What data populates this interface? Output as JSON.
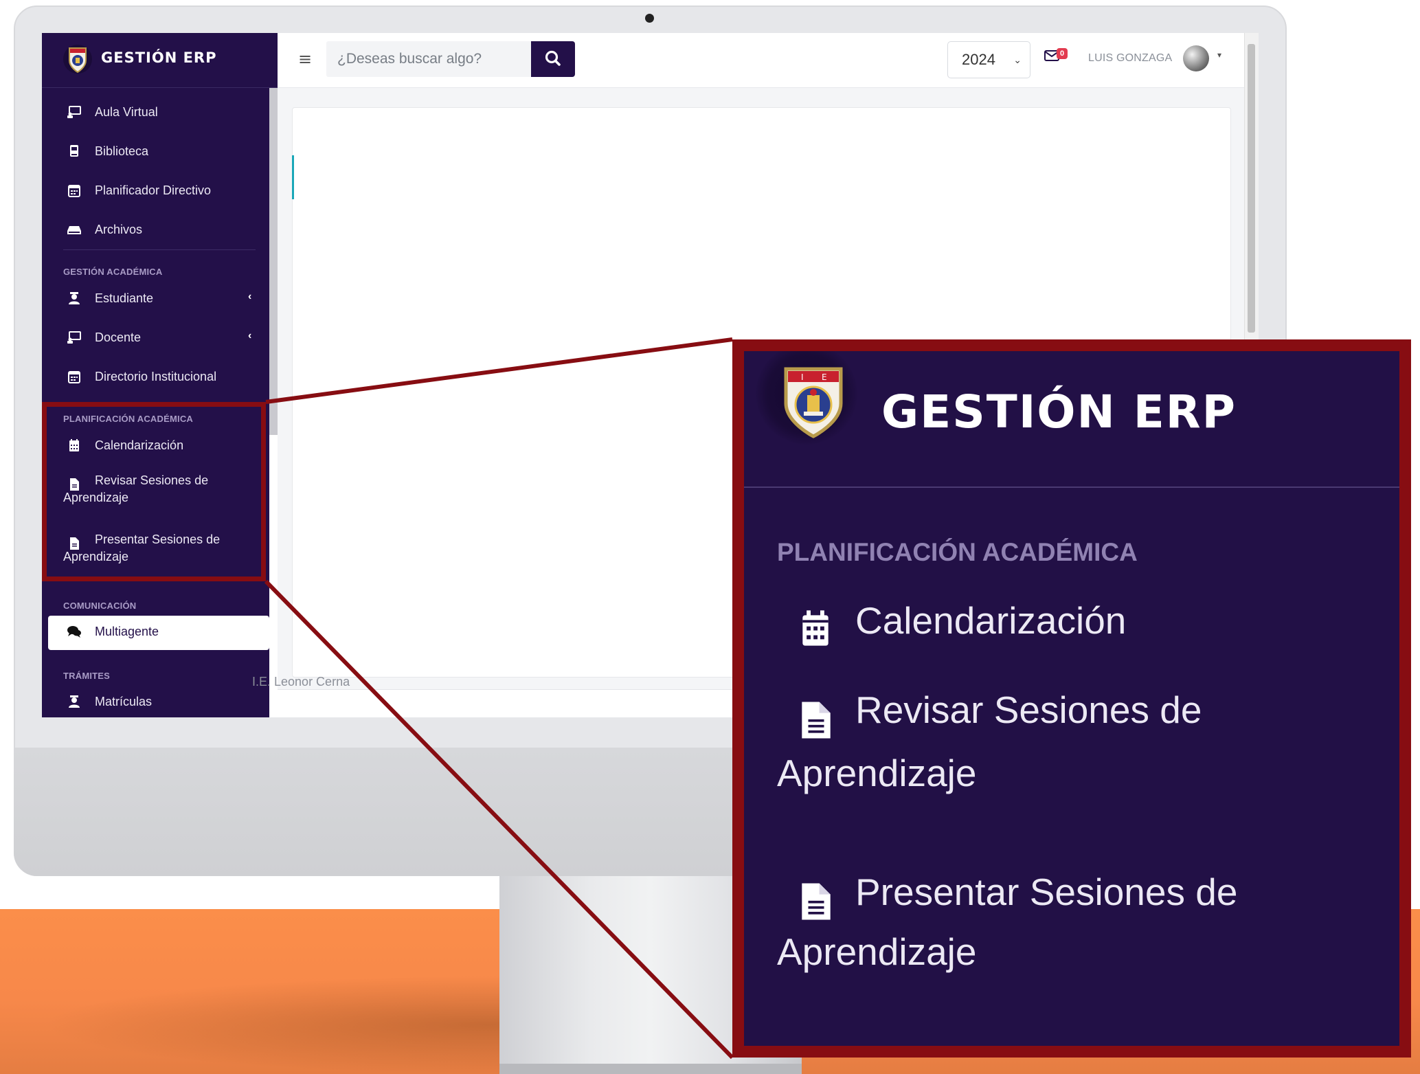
{
  "app": {
    "brand": "GESTIÓN ERP"
  },
  "topbar": {
    "search_placeholder": "¿Deseas buscar algo?",
    "year": "2024",
    "mail_count": "0",
    "username": "LUIS GONZAGA"
  },
  "sidebar": {
    "items_top": [
      {
        "label": "Aula Virtual",
        "icon": "chalkboard-icon"
      },
      {
        "label": "Biblioteca",
        "icon": "book-icon"
      },
      {
        "label": "Planificador Directivo",
        "icon": "calendar-icon"
      },
      {
        "label": "Archivos",
        "icon": "hdd-icon"
      }
    ],
    "section_academica": {
      "heading": "GESTIÓN ACADÉMICA",
      "items": [
        {
          "label": "Estudiante",
          "icon": "user-graduate-icon"
        },
        {
          "label": "Docente",
          "icon": "chalkboard-teacher-icon"
        },
        {
          "label": "Directorio Institucional",
          "icon": "calendar-icon"
        }
      ]
    },
    "section_planificacion": {
      "heading": "PLANIFICACIÓN ACADÉMICA",
      "items": [
        {
          "label": "Calendarización",
          "icon": "calendar-alt-icon"
        },
        {
          "label_line1": "Revisar Sesiones de",
          "label_line2": "Aprendizaje",
          "icon": "file-alt-icon"
        },
        {
          "label_line1": "Presentar Sesiones de",
          "label_line2": "Aprendizaje",
          "icon": "file-alt-icon"
        }
      ]
    },
    "section_comunicacion": {
      "heading": "COMUNICACIÓN",
      "items": [
        {
          "label": "Multiagente",
          "icon": "comments-icon",
          "active": true
        }
      ]
    },
    "section_tramites": {
      "heading": "TRÁMITES",
      "items": [
        {
          "label": "Matrículas",
          "icon": "user-graduate-icon"
        }
      ]
    }
  },
  "footer": {
    "text": "I.E. Leonor Cerna"
  },
  "zoom": {
    "brand": "GESTIÓN ERP",
    "heading": "PLANIFICACIÓN ACADÉMICA",
    "item1": "Calendarización",
    "item2_line1": "Revisar Sesiones de",
    "item2_line2": "Aprendizaje",
    "item3_line1": "Presentar Sesiones de",
    "item3_line2": "Aprendizaje"
  },
  "colors": {
    "sidebar_bg": "#231049",
    "accent_orange": "#fb8e4a",
    "callout_red": "#870d12",
    "badge_red": "#e23b4f"
  }
}
